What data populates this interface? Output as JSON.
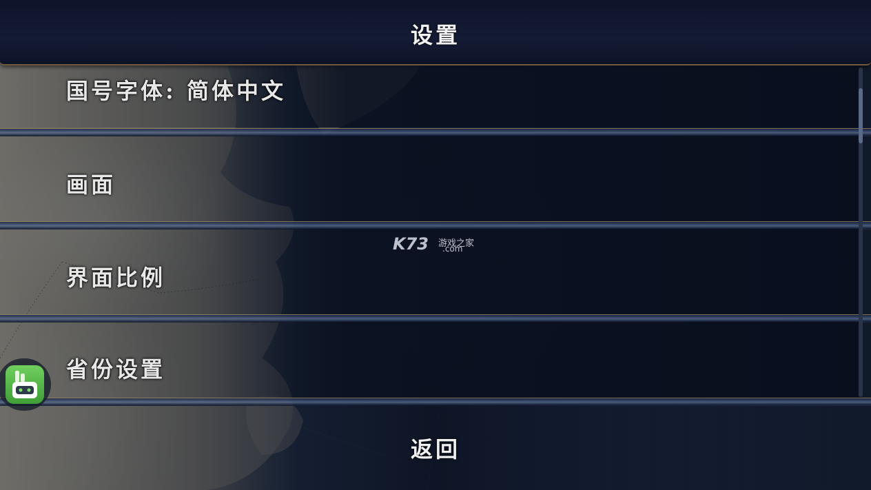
{
  "header": {
    "title": "设置"
  },
  "settings": {
    "items": [
      {
        "label": "国号字体: 简体中文"
      },
      {
        "label": "画面"
      },
      {
        "label": "界面比例"
      },
      {
        "label": "省份设置"
      }
    ]
  },
  "footer": {
    "back_label": "返回"
  },
  "watermark": {
    "brand": "K73",
    "site_cn": "游戏之家",
    "domain": ".com"
  },
  "colors": {
    "accent_border": "#6f5a40",
    "header_bg": "#141b34",
    "text": "#e8e8e8"
  }
}
